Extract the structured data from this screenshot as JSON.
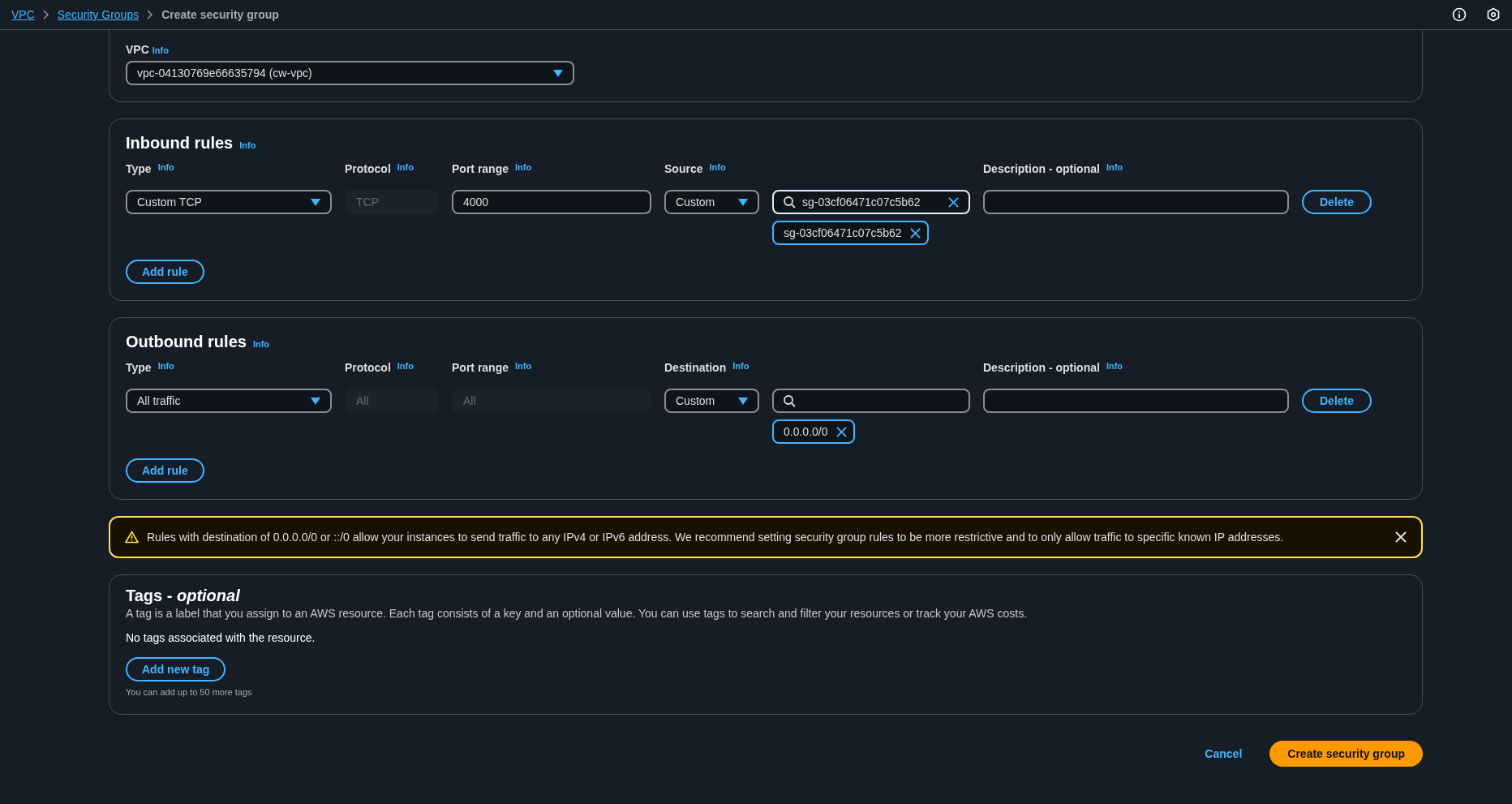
{
  "breadcrumb": [
    {
      "label": "VPC",
      "kind": "link"
    },
    {
      "label": "Security Groups",
      "kind": "link"
    },
    {
      "label": "Create security group",
      "kind": "current"
    }
  ],
  "vpc": {
    "label": "VPC",
    "info": "Info",
    "value": "vpc-04130769e66635794 (cw-vpc)"
  },
  "rule_sections": [
    {
      "title": "Inbound rules",
      "info": "Info",
      "columns": [
        {
          "label": "Type",
          "info": "Info"
        },
        {
          "label": "Protocol",
          "info": "Info"
        },
        {
          "label": "Port range",
          "info": "Info"
        },
        {
          "label": "Source",
          "info": "Info"
        },
        {
          "label": "Description - optional",
          "info": "Info"
        }
      ],
      "rules": [
        {
          "type": "Custom TCP",
          "protocol": {
            "value": "TCP",
            "disabled": true
          },
          "port_range": {
            "value": "4000",
            "disabled": false
          },
          "target": "Custom",
          "search": {
            "value": "sg-03cf06471c07c5b62",
            "focused": true
          },
          "tokens": [
            "sg-03cf06471c07c5b62"
          ],
          "delete": "Delete"
        }
      ],
      "add_button": "Add rule"
    },
    {
      "title": "Outbound rules",
      "info": "Info",
      "columns": [
        {
          "label": "Type",
          "info": "Info"
        },
        {
          "label": "Protocol",
          "info": "Info"
        },
        {
          "label": "Port range",
          "info": "Info"
        },
        {
          "label": "Destination",
          "info": "Info"
        },
        {
          "label": "Description - optional",
          "info": "Info"
        }
      ],
      "rules": [
        {
          "type": "All traffic",
          "protocol": {
            "value": "All",
            "disabled": true
          },
          "port_range": {
            "value": "All",
            "disabled": true
          },
          "target": "Custom",
          "search": {
            "focused": false
          },
          "tokens": [
            "0.0.0.0/0"
          ],
          "delete": "Delete"
        }
      ],
      "add_button": "Add rule"
    }
  ],
  "warning": {
    "text": "Rules with destination of 0.0.0.0/0 or ::/0 allow your instances to send traffic to any IPv4 or IPv6 address. We recommend setting security group rules to be more restrictive and to only allow traffic to specific known IP addresses."
  },
  "tags": {
    "title": "Tags - *optional*",
    "description": "A tag is a label that you assign to an AWS resource. Each tag consists of a key and an optional value. You can use tags to search and filter your resources or track your AWS costs.",
    "empty": "No tags associated with the resource.",
    "add_button": "Add new tag",
    "hint": "You can add up to 50 more tags"
  },
  "footer": {
    "cancel": "Cancel",
    "submit": "Create security group"
  }
}
